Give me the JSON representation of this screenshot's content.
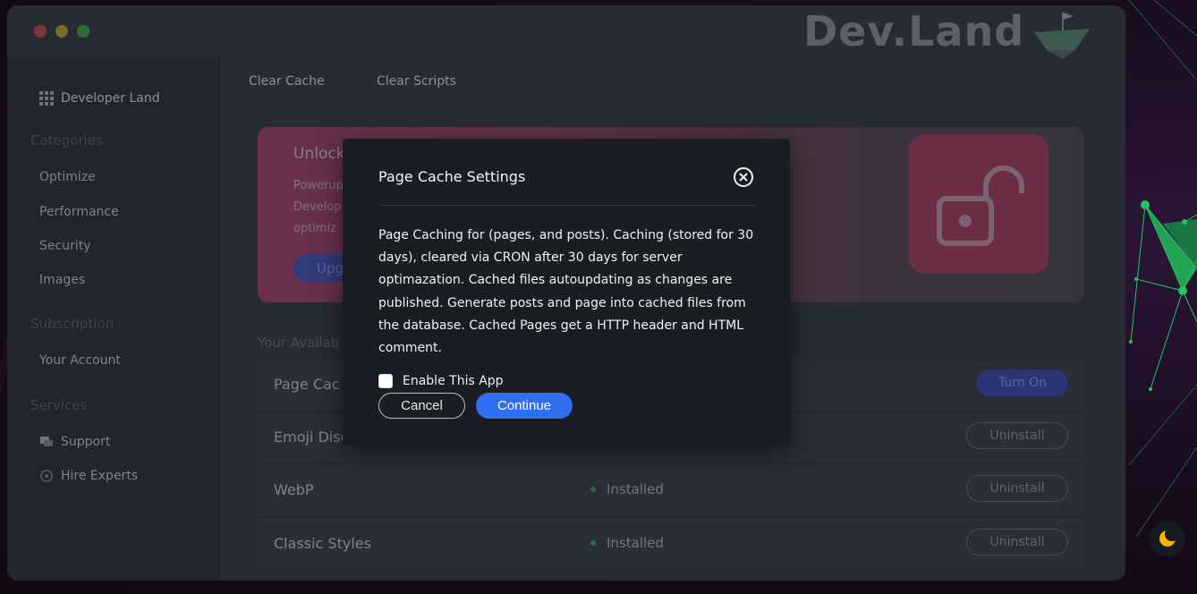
{
  "app": {
    "logo_text": "Dev.Land",
    "window_buttons": [
      "close",
      "minimize",
      "maximize"
    ]
  },
  "sidebar": {
    "brand": "Developer Land",
    "sections": [
      {
        "heading": "Categories",
        "items": [
          "Optimize",
          "Performance",
          "Security",
          "Images"
        ]
      },
      {
        "heading": "Subscription",
        "items": [
          "Your Account"
        ]
      },
      {
        "heading": "Services",
        "items": [
          "Support",
          "Hire Experts"
        ]
      }
    ]
  },
  "tabs": [
    "Clear Cache",
    "Clear Scripts"
  ],
  "banner": {
    "title": "Unlock",
    "text_lines": [
      "Powerup",
      "Develop",
      "optimiz"
    ],
    "button_label": "Upg"
  },
  "apps_section": {
    "title": "Your Availab",
    "rows": [
      {
        "name": "Page Cac",
        "status": "",
        "button": "Turn On"
      },
      {
        "name": "Emoji Disc",
        "status": "",
        "button": "Uninstall"
      },
      {
        "name": "WebP",
        "status": "Installed",
        "button": "Uninstall"
      },
      {
        "name": "Classic Styles",
        "status": "Installed",
        "button": "Uninstall"
      }
    ]
  },
  "modal": {
    "title": "Page Cache Settings",
    "body": "Page Caching for (pages, and posts). Caching (stored for 30 days), cleared via CRON after 30 days for server optimazation. Cached files autoupdating as changes are published. Generate posts and page into cached files from the database. Cached Pages get a HTTP header and HTML comment.",
    "checkbox_label": "Enable This App",
    "checkbox_checked": false,
    "cancel_label": "Cancel",
    "continue_label": "Continue"
  },
  "colors": {
    "accent": "#2f6ef0",
    "modal_bg": "#1a1d24",
    "window_bg": "#272b34"
  },
  "icons": {
    "brand": "grid-icon",
    "support": "chat-icon",
    "hire": "headset-icon",
    "close": "close-circle-icon",
    "lock": "unlock-icon",
    "theme": "moon-icon"
  }
}
